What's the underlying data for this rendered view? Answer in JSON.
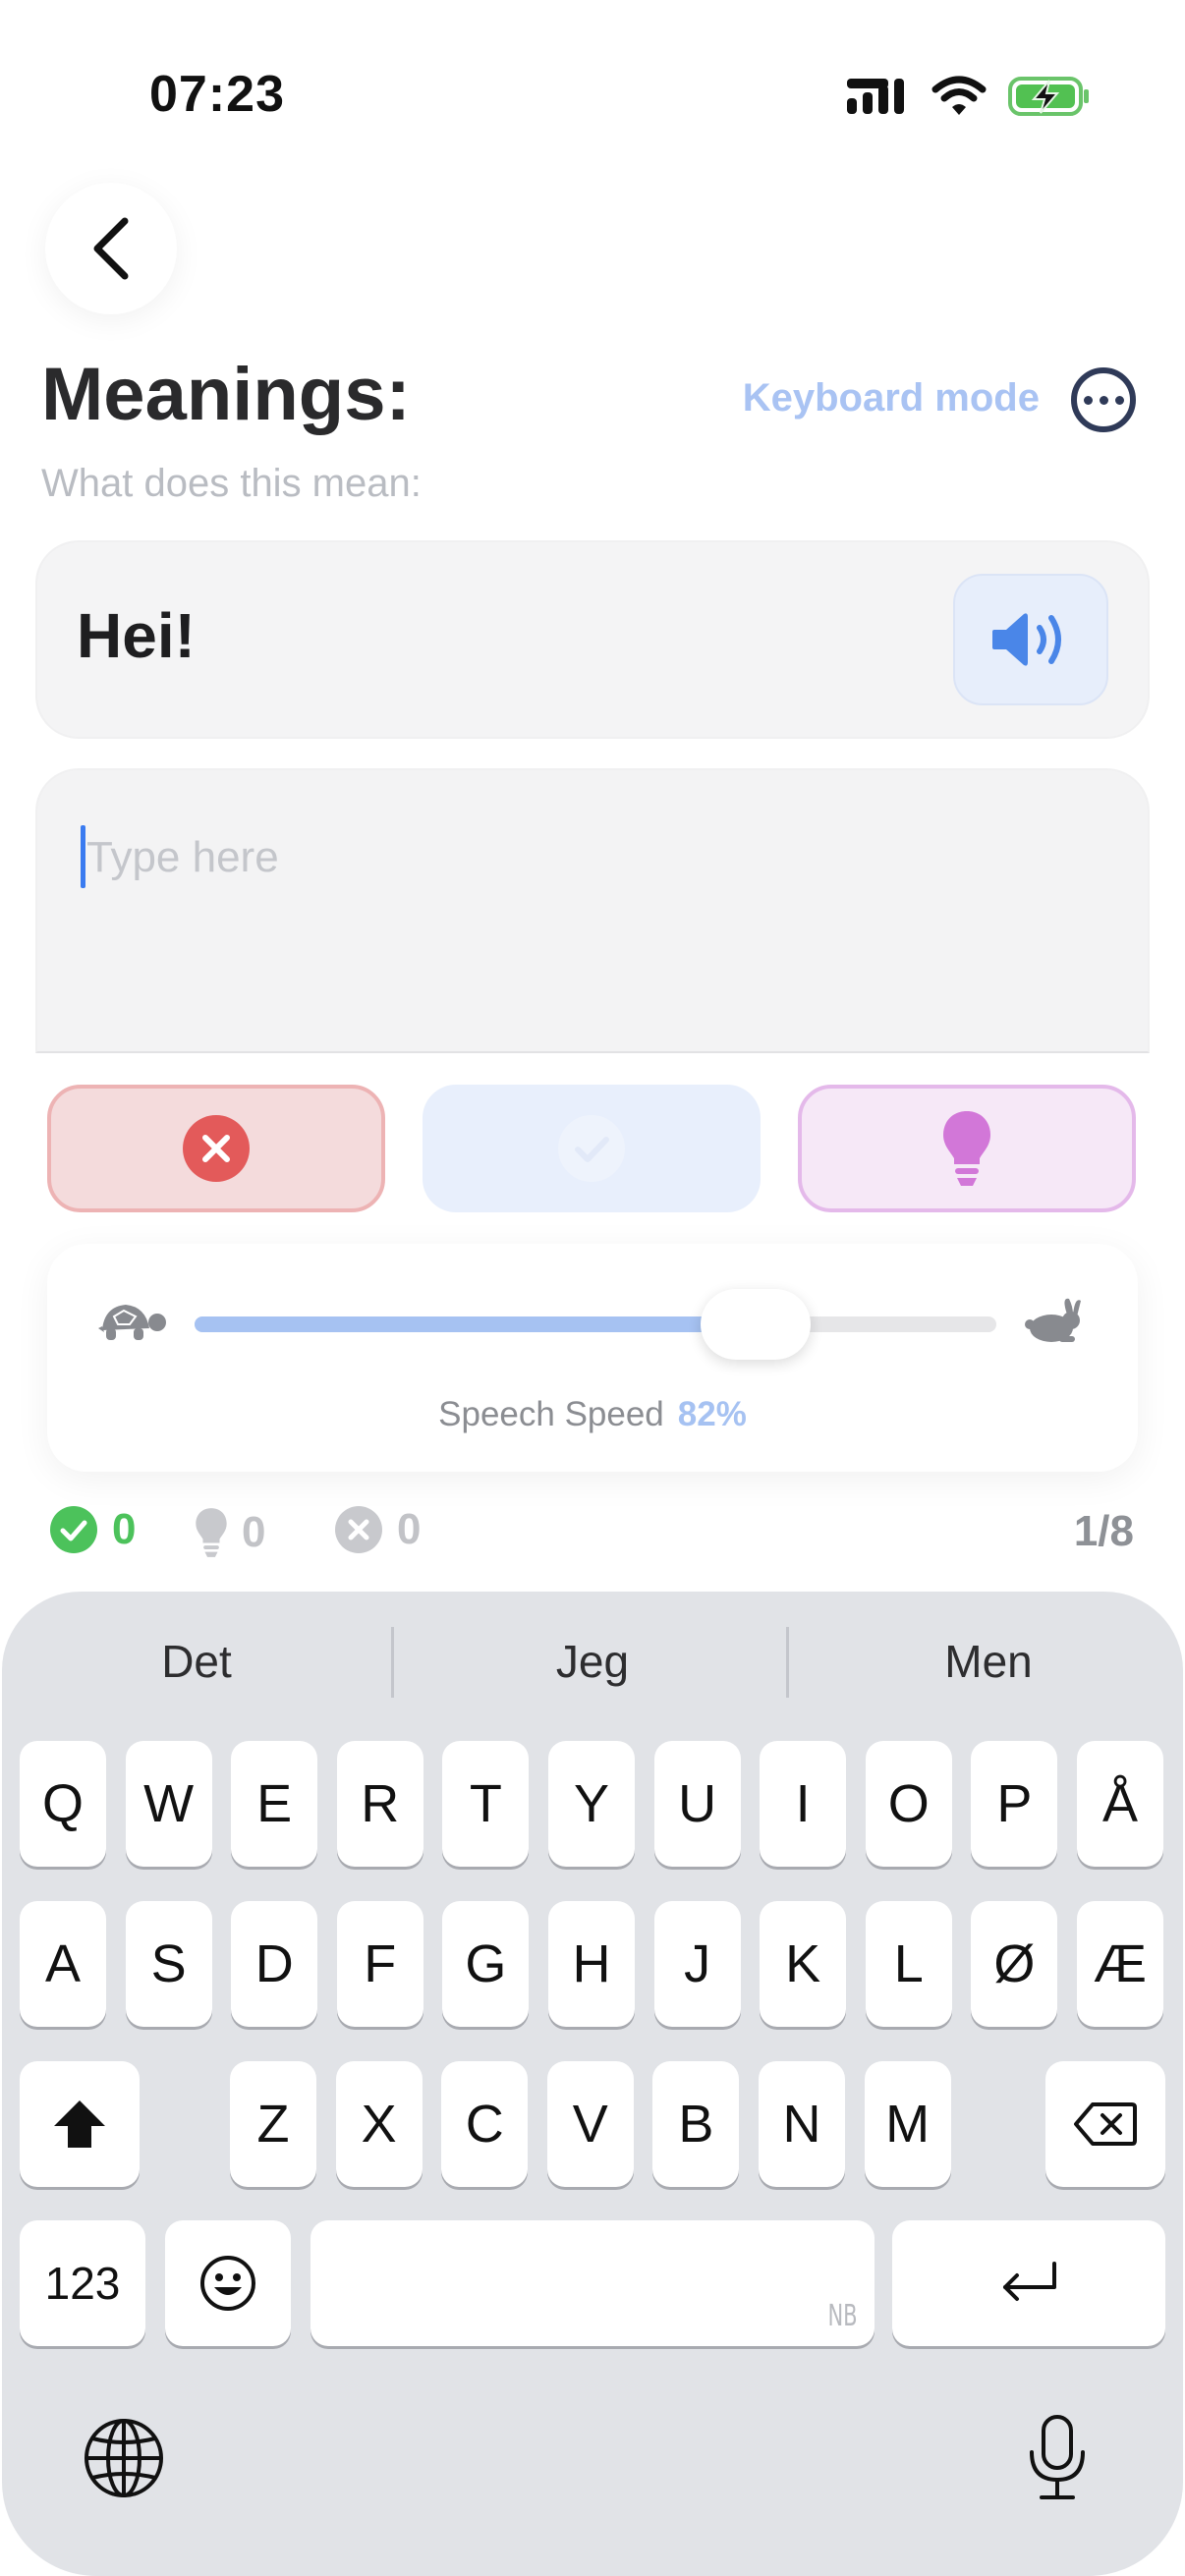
{
  "status_bar": {
    "time": "07:23",
    "icons": [
      "cellular-signal-icon",
      "wifi-icon",
      "battery-charging-icon"
    ]
  },
  "header": {
    "title": "Meanings:",
    "subtitle": "What does this mean:",
    "keyboard_mode_label": "Keyboard mode"
  },
  "prompt": {
    "word": "Hei!"
  },
  "answer": {
    "placeholder": "Type here",
    "value": ""
  },
  "actions": {
    "wrong_icon": "x-circle-icon",
    "check_icon": "check-circle-icon",
    "hint_icon": "lightbulb-icon"
  },
  "speech": {
    "label": "Speech Speed",
    "percent_text": "82%",
    "value": 0.7,
    "slow_icon": "turtle-icon",
    "fast_icon": "rabbit-icon"
  },
  "stats": {
    "correct": "0",
    "hints": "0",
    "wrong": "0",
    "progress": "1/8"
  },
  "keyboard": {
    "suggestions": [
      "Det",
      "Jeg",
      "Men"
    ],
    "row1": [
      "Q",
      "W",
      "E",
      "R",
      "T",
      "Y",
      "U",
      "I",
      "O",
      "P",
      "Å"
    ],
    "row2": [
      "A",
      "S",
      "D",
      "F",
      "G",
      "H",
      "J",
      "K",
      "L",
      "Ø",
      "Æ"
    ],
    "row3": [
      "Z",
      "X",
      "C",
      "V",
      "B",
      "N",
      "M"
    ],
    "numbers_key": "123",
    "space_language": "NB"
  },
  "colors": {
    "accent_blue": "#a6c2f2",
    "correct_green": "#4cc25b",
    "wrong_red": "#e35a5a",
    "hint_purple": "#d277d8",
    "dark_navy": "#2f3a58"
  }
}
